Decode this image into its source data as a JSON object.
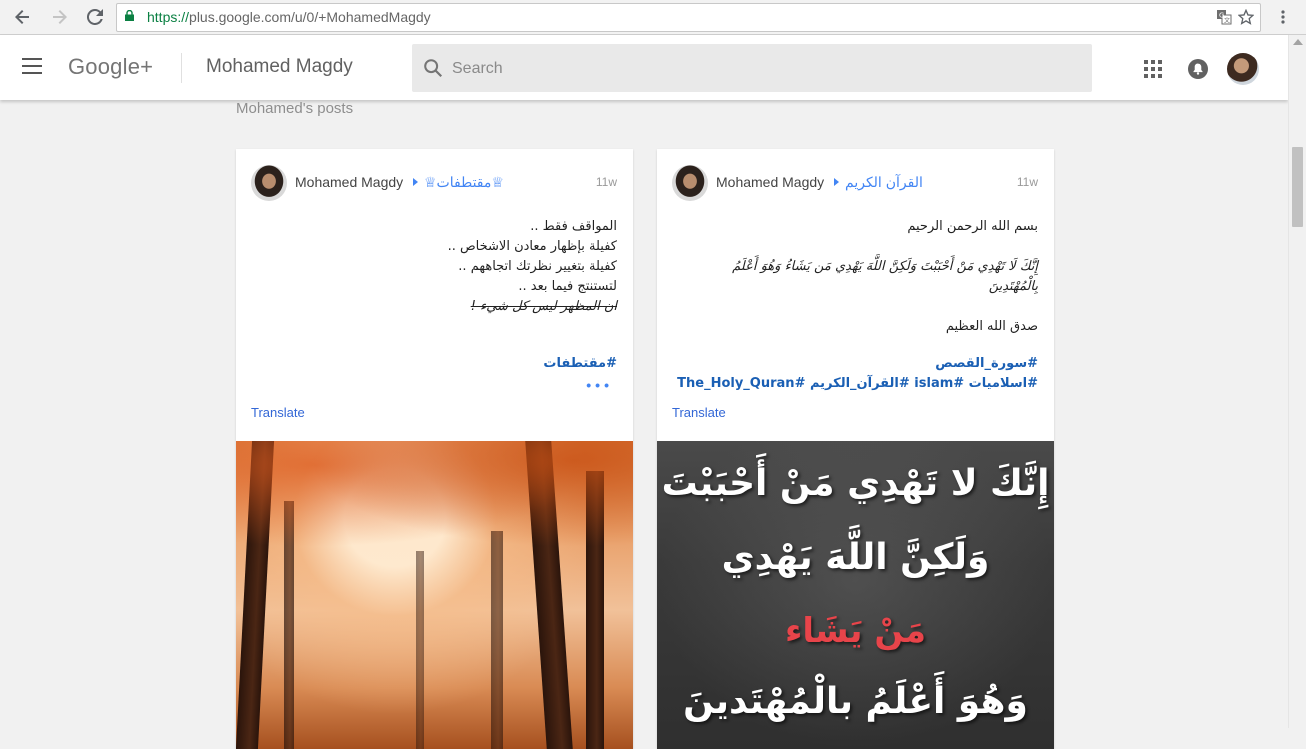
{
  "browser": {
    "url_scheme": "https://",
    "url_rest": "plus.google.com/u/0/+MohamedMagdy"
  },
  "header": {
    "brand": "Google+",
    "profile_name": "Mohamed Magdy",
    "search_placeholder": "Search"
  },
  "section_title": "Mohamed's posts",
  "posts": [
    {
      "author": "Mohamed Magdy",
      "collection": "♕مقتطفات♕",
      "time": "11w",
      "lines": [
        "المواقف فقط ..",
        "كفيلة بإظهار معادن الاشخاص ..",
        "كفيلة بتغيير نظرتك اتجاههم ..",
        "لتستنتج فيما بعد ..",
        "ان المظهر ليس كل شيء !"
      ],
      "hashtag": "#مقتطفات",
      "translate": "Translate"
    },
    {
      "author": "Mohamed Magdy",
      "collection": "القرآن الكريم",
      "time": "11w",
      "lines": [
        "بسم الله الرحمن الرحيم",
        "",
        "إِنَّكَ لَا تَهْدِي مَنْ أَحْبَبْتَ وَلَكِنَّ اللَّهَ يَهْدِي مَن يَشَاءُ وَهُوَ أَعْلَمُ",
        "بِالْمُهْتَدِينَ",
        "",
        "صدق الله العظيم"
      ],
      "hashtag": "#سورة_القصص",
      "tags": "#اسلاميات  #islam  #القرآن_الكريم  #The_Holy_Quran",
      "translate": "Translate",
      "image_lines": [
        "إِنَّكَ لا تَهْدِي مَنْ أَحْبَبْتَ",
        "وَلَكِنَّ اللَّهَ يَهْدِي",
        "مَنْ يَشَاء",
        "وَهُوَ أَعْلَمُ بالْمُهْتَدينَ"
      ]
    }
  ],
  "colors": {
    "accent": "#4285f4",
    "link": "#3367d6",
    "quran_highlight": "#e8444a"
  }
}
